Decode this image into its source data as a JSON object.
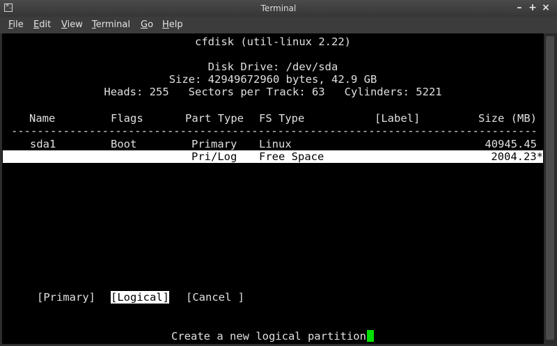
{
  "window": {
    "title": "Terminal",
    "icons": {
      "app": "terminal-icon",
      "minimize": "minimize-icon",
      "maximize": "maximize-icon",
      "close": "close-icon"
    },
    "controls": {
      "minimize": "–",
      "maximize": "+",
      "close": "×"
    }
  },
  "menubar": {
    "file": {
      "mnemonic": "F",
      "rest": "ile"
    },
    "edit": {
      "mnemonic": "E",
      "rest": "dit"
    },
    "view": {
      "mnemonic": "V",
      "rest": "iew"
    },
    "terminal": {
      "mnemonic": "T",
      "rest": "erminal"
    },
    "go": {
      "mnemonic": "G",
      "rest": "o"
    },
    "help": {
      "mnemonic": "H",
      "rest": "elp"
    }
  },
  "cfdisk": {
    "title": "cfdisk (util-linux 2.22)",
    "disk_drive": "Disk Drive: /dev/sda",
    "size": "Size: 42949672960 bytes, 42.9 GB",
    "geometry": "Heads: 255   Sectors per Track: 63   Cylinders: 5221",
    "columns": {
      "name": "Name",
      "flags": "Flags",
      "part_type": "Part Type",
      "fs_type": "FS Type",
      "label": "[Label]",
      "size": "Size (MB)"
    },
    "separator": "------------------------------------------------------------------------------------------------------------",
    "partitions": [
      {
        "name": "sda1",
        "flags": "Boot",
        "part_type": "Primary",
        "fs_type": "Linux",
        "size": "40945.45"
      },
      {
        "name": "",
        "flags": "",
        "part_type": "Pri/Log",
        "fs_type": "Free Space",
        "size": "2004.23*"
      }
    ],
    "buttons": {
      "primary": "[Primary]",
      "logical": "[Logical]",
      "cancel": "[Cancel ]"
    },
    "selected_button": "logical",
    "status": "Create a new logical partition"
  },
  "colors": {
    "terminal_bg": "#000000",
    "terminal_fg": "#e0e0e0",
    "highlight_bg": "#ffffff",
    "cursor": "#00e000"
  }
}
